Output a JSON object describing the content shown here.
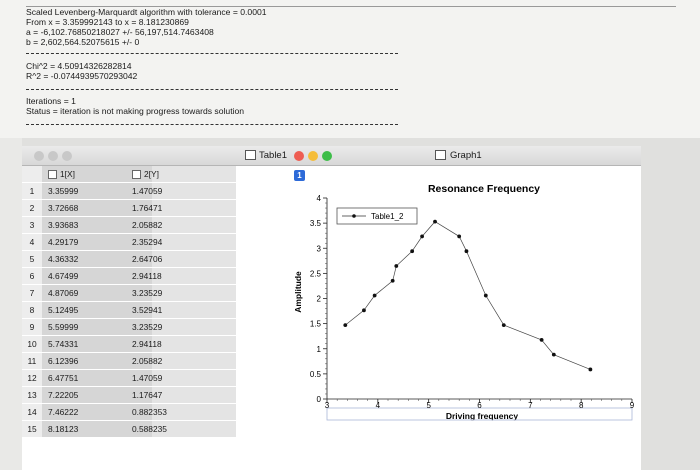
{
  "log": {
    "lines_block1": [
      "Scaled Levenberg-Marquardt algorithm with tolerance = 0.0001",
      "From x = 3.359992143 to x = 8.181230869",
      "a = -6,102.76850218027 +/- 56,197,514.7463408",
      "b = 2,602,564.52075615 +/- 0"
    ],
    "lines_block2": [
      "Chi^2 = 4.50914326282814",
      "R^2 = -0.0744939570293042"
    ],
    "lines_block3": [
      "Iterations = 1",
      "Status = iteration is not making progress towards solution"
    ]
  },
  "table_window": {
    "title": "Table1",
    "col_x": "1[X]",
    "col_y": "2[Y]",
    "rows": [
      {
        "n": "1",
        "x": "3.35999",
        "y": "1.47059"
      },
      {
        "n": "2",
        "x": "3.72668",
        "y": "1.76471"
      },
      {
        "n": "3",
        "x": "3.93683",
        "y": "2.05882"
      },
      {
        "n": "4",
        "x": "4.29179",
        "y": "2.35294"
      },
      {
        "n": "5",
        "x": "4.36332",
        "y": "2.64706"
      },
      {
        "n": "6",
        "x": "4.67499",
        "y": "2.94118"
      },
      {
        "n": "7",
        "x": "4.87069",
        "y": "3.23529"
      },
      {
        "n": "8",
        "x": "5.12495",
        "y": "3.52941"
      },
      {
        "n": "9",
        "x": "5.59999",
        "y": "3.23529"
      },
      {
        "n": "10",
        "x": "5.74331",
        "y": "2.94118"
      },
      {
        "n": "11",
        "x": "6.12396",
        "y": "2.05882"
      },
      {
        "n": "12",
        "x": "6.47751",
        "y": "1.47059"
      },
      {
        "n": "13",
        "x": "7.22205",
        "y": "1.17647"
      },
      {
        "n": "14",
        "x": "7.46222",
        "y": "0.882353"
      },
      {
        "n": "15",
        "x": "8.18123",
        "y": "0.588235"
      }
    ]
  },
  "graph_window": {
    "title": "Graph1",
    "badge": "1"
  },
  "colors": {
    "traffic_red": "#ee5d52",
    "traffic_yellow": "#f5bd3a",
    "traffic_green": "#3dbd48",
    "badge_blue": "#2d6ad8"
  },
  "chart_data": {
    "type": "line",
    "title": "Resonance Frequency",
    "xlabel": "Driving frequency",
    "ylabel": "Amplitude",
    "xlim": [
      3,
      9
    ],
    "ylim": [
      0,
      4
    ],
    "xticks": [
      "3",
      "4",
      "5",
      "6",
      "7",
      "8",
      "9"
    ],
    "yticks": [
      "0",
      "0.5",
      "1",
      "1.5",
      "2",
      "2.5",
      "3",
      "3.5",
      "4"
    ],
    "legend_position": "top-left",
    "grid": false,
    "series": [
      {
        "name": "Table1_2",
        "x": [
          3.35999,
          3.72668,
          3.93683,
          4.29179,
          4.36332,
          4.67499,
          4.87069,
          5.12495,
          5.59999,
          5.74331,
          6.12396,
          6.47751,
          7.22205,
          7.46222,
          8.18123
        ],
        "y": [
          1.47059,
          1.76471,
          2.05882,
          2.35294,
          2.64706,
          2.94118,
          3.23529,
          3.52941,
          3.23529,
          2.94118,
          2.05882,
          1.47059,
          1.17647,
          0.882353,
          0.588235
        ]
      }
    ]
  }
}
